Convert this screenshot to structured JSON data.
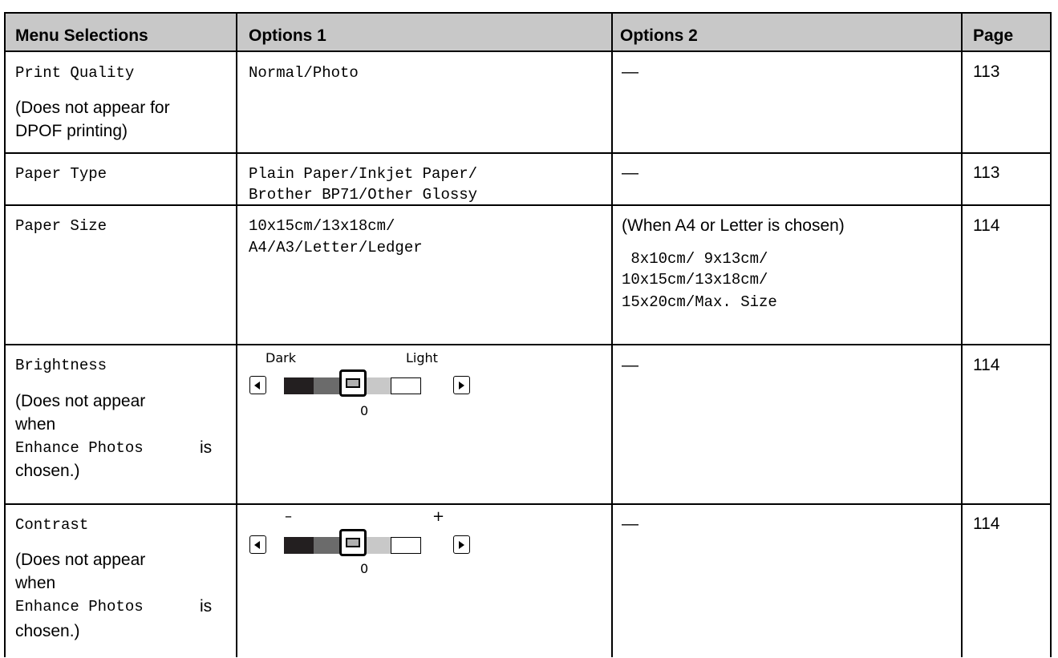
{
  "headers": [
    "Menu Selections",
    "Options 1",
    "Options 2",
    "Page"
  ],
  "rows": [
    {
      "menu": "Print Quality",
      "menu_note": [
        "(Does not appear for",
        "DPOF printing)"
      ],
      "options1": [
        "Normal/Photo"
      ],
      "options2": "—",
      "page": "113"
    },
    {
      "menu": "Paper Type",
      "options1": [
        "Plain Paper/Inkjet Paper/",
        "Brother BP71/Other Glossy"
      ],
      "options2": "—",
      "page": "113"
    },
    {
      "menu": "Paper Size",
      "options1": [
        "10x15cm/13x18cm/",
        "A4/A3/Letter/Ledger"
      ],
      "options2_note": "(When A4 or Letter is chosen)",
      "options2_values": [
        " 8x10cm/ 9x13cm/",
        "10x15cm/13x18cm/",
        "15x20cm/Max. Size"
      ],
      "page": "114"
    },
    {
      "menu": "Brightness",
      "menu_note": [
        "(Does not appear",
        "when"
      ],
      "menu_note_mono": "Enhance Photos",
      "menu_note_is": "is",
      "menu_note_end": "chosen.)",
      "slider": {
        "left_label": "Dark",
        "right_label": "Light",
        "value": "0"
      },
      "options2": "—",
      "page": "114"
    },
    {
      "menu": "Contrast",
      "menu_note": [
        "(Does not appear",
        "when"
      ],
      "menu_note_mono": "Enhance Photos",
      "menu_note_is": "is",
      "menu_note_end": "chosen.)",
      "slider": {
        "left_label": "–",
        "right_label": "+",
        "value": "0"
      },
      "options2": "—",
      "page": "114"
    }
  ]
}
